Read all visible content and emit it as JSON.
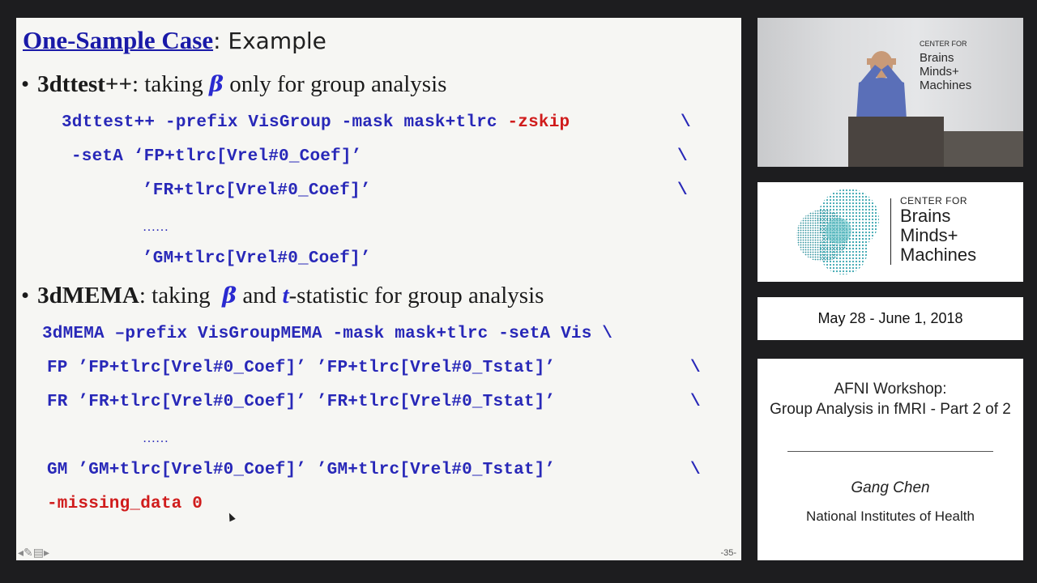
{
  "slide": {
    "title_link": "One-Sample Case",
    "title_rest": ": Example",
    "bullet1": {
      "dot": "•",
      "bold": "3dttest++",
      "text_a": ": taking ",
      "beta": "β",
      "text_b": " only for group analysis"
    },
    "code1": {
      "line1_main": "3dttest++ -prefix VisGroup -mask mask+tlrc ",
      "line1_red": "-zskip",
      "line1_cont": "\\",
      "line2": "-setA ‘FP+tlrc[Vrel#0_Coef]’",
      "line2_cont": "\\",
      "line3": "’FR+tlrc[Vrel#0_Coef]’",
      "line3_cont": "\\",
      "ellipsis": "……",
      "line4": "’GM+tlrc[Vrel#0_Coef]’"
    },
    "bullet2": {
      "dot": "•",
      "bold": "3dMEMA",
      "text_a": ": taking  ",
      "beta": "β",
      "text_b": " and ",
      "t": "t",
      "text_c": "-statistic for group analysis"
    },
    "code2": {
      "line1": "3dMEMA –prefix VisGroupMEMA -mask mask+tlrc -setA Vis \\",
      "line2": "FP ’FP+tlrc[Vrel#0_Coef]’ ’FP+tlrc[Vrel#0_Tstat]’",
      "line2_cont": "\\",
      "line3": "FR ’FR+tlrc[Vrel#0_Coef]’ ’FR+tlrc[Vrel#0_Tstat]’",
      "line3_cont": "\\",
      "ellipsis": "……",
      "line4": "GM ’GM+tlrc[Vrel#0_Coef]’ ’GM+tlrc[Vrel#0_Tstat]’",
      "line4_cont": "\\",
      "line5_red": "-missing_data 0"
    },
    "nav_icons": "◂✎▤▸",
    "page_number": "-35-"
  },
  "video": {
    "sign_small": "CENTER FOR",
    "sign_l1": "Brains",
    "sign_l2": "Minds+",
    "sign_l3": "Machines"
  },
  "logo": {
    "center_for": "CENTER FOR",
    "line1": "Brains",
    "line2": "Minds+",
    "line3": "Machines"
  },
  "event": {
    "date": "May 28 - June 1, 2018",
    "title_line1": "AFNI Workshop:",
    "title_line2": "Group Analysis in fMRI - Part 2 of 2",
    "speaker": "Gang Chen",
    "institution": "National Institutes of Health"
  },
  "colors": {
    "title_link": "#1a1aa8",
    "code_blue": "#2828b8",
    "code_red": "#d01c1c",
    "logo_teal": "#3aa6b0"
  }
}
